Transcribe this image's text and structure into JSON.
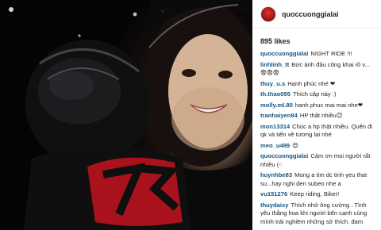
{
  "post": {
    "username": "quoccuonggialai",
    "likes": "895 likes"
  },
  "comments": [
    {
      "user": "quoccuonggialai",
      "text": "NIGHT RIDE !!!"
    },
    {
      "user": "linhlinh_tt",
      "text": "Bức ảnh đầu công khai rồ v...😨😨😨"
    },
    {
      "user": "thuy_u.s",
      "text": "Hạnh phúc nhé ❤"
    },
    {
      "user": "th.thao095",
      "text": "Thích cặp này :)"
    },
    {
      "user": "molly.ml.80",
      "text": "hanh phuc mai mai nhe❤"
    },
    {
      "user": "tranhaiyen84",
      "text": "HP thật nhiều😊"
    },
    {
      "user": "mon13314",
      "text": "Chúc a hp thật nhiều. Quên đi qk và tiến về tương lai nhé"
    },
    {
      "user": "meo_u489",
      "text": "😍"
    },
    {
      "user": "quoccuonggialai",
      "text": "Cảm ơn mọi người rất nhiều (-:"
    },
    {
      "user": "huynhbe83",
      "text": "Mong a tim dc tinh yeu that su...hay nghi den subeo nhe a"
    },
    {
      "user": "vu151276",
      "text": "Keep riding, Biker!"
    },
    {
      "user": "thuydaisy",
      "text": "Thích nhớ ông cường . Tình yêu thằng hoa khi người bên cạnh cùng mình trải nghiệm những sở thích. đam"
    }
  ],
  "colors": {
    "username": "#125688",
    "text": "#262626",
    "avatar": "#c8201e"
  },
  "icons": [
    "avatar"
  ]
}
